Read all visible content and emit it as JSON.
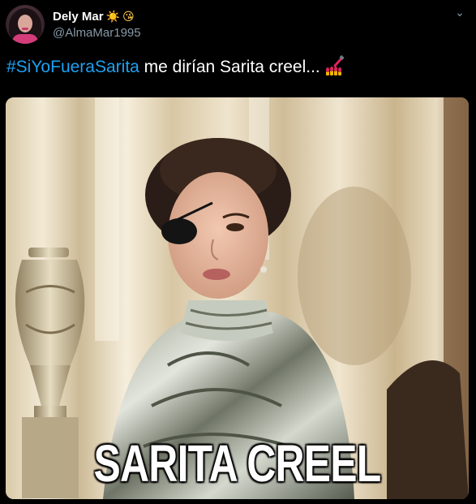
{
  "tweet": {
    "author": {
      "display_name": "Dely Mar",
      "name_emojis": [
        "☀️",
        "😘"
      ],
      "handle": "@AlmaMar1995",
      "avatar_icon": "profile-avatar"
    },
    "text": {
      "hashtag": "#SiYoFueraSarita",
      "body": " me dirían Sarita creel...",
      "trailing_emoji_icon": "nail-polish-icon"
    },
    "media": {
      "caption": "SARITA CREEL"
    },
    "menu_icon": "more-options-icon"
  },
  "colors": {
    "background": "#000000",
    "hashtag": "#1da1f2",
    "handle": "#8899a6",
    "text": "#ffffff"
  }
}
